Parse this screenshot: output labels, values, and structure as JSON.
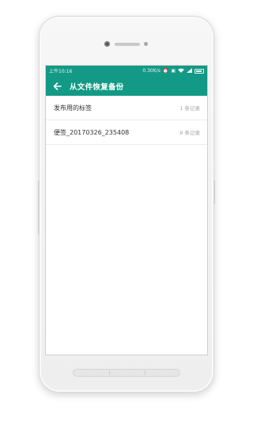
{
  "status_bar": {
    "time": "上午10:16",
    "speed": "0.30K/s",
    "icons": [
      "alarm-icon",
      "vibrate-icon",
      "wifi-icon",
      "signal-icon",
      "battery-icon"
    ]
  },
  "app_bar": {
    "back_icon": "arrow-left-icon",
    "title": "从文件恢复备份"
  },
  "backups": [
    {
      "name": "发布用的标签",
      "count": "1 条记录"
    },
    {
      "name": "便签_20170326_235408",
      "count": "8 条记录"
    }
  ],
  "colors": {
    "primary": "#139a86",
    "text": "#333333",
    "secondary_text": "#a6a6a6"
  }
}
